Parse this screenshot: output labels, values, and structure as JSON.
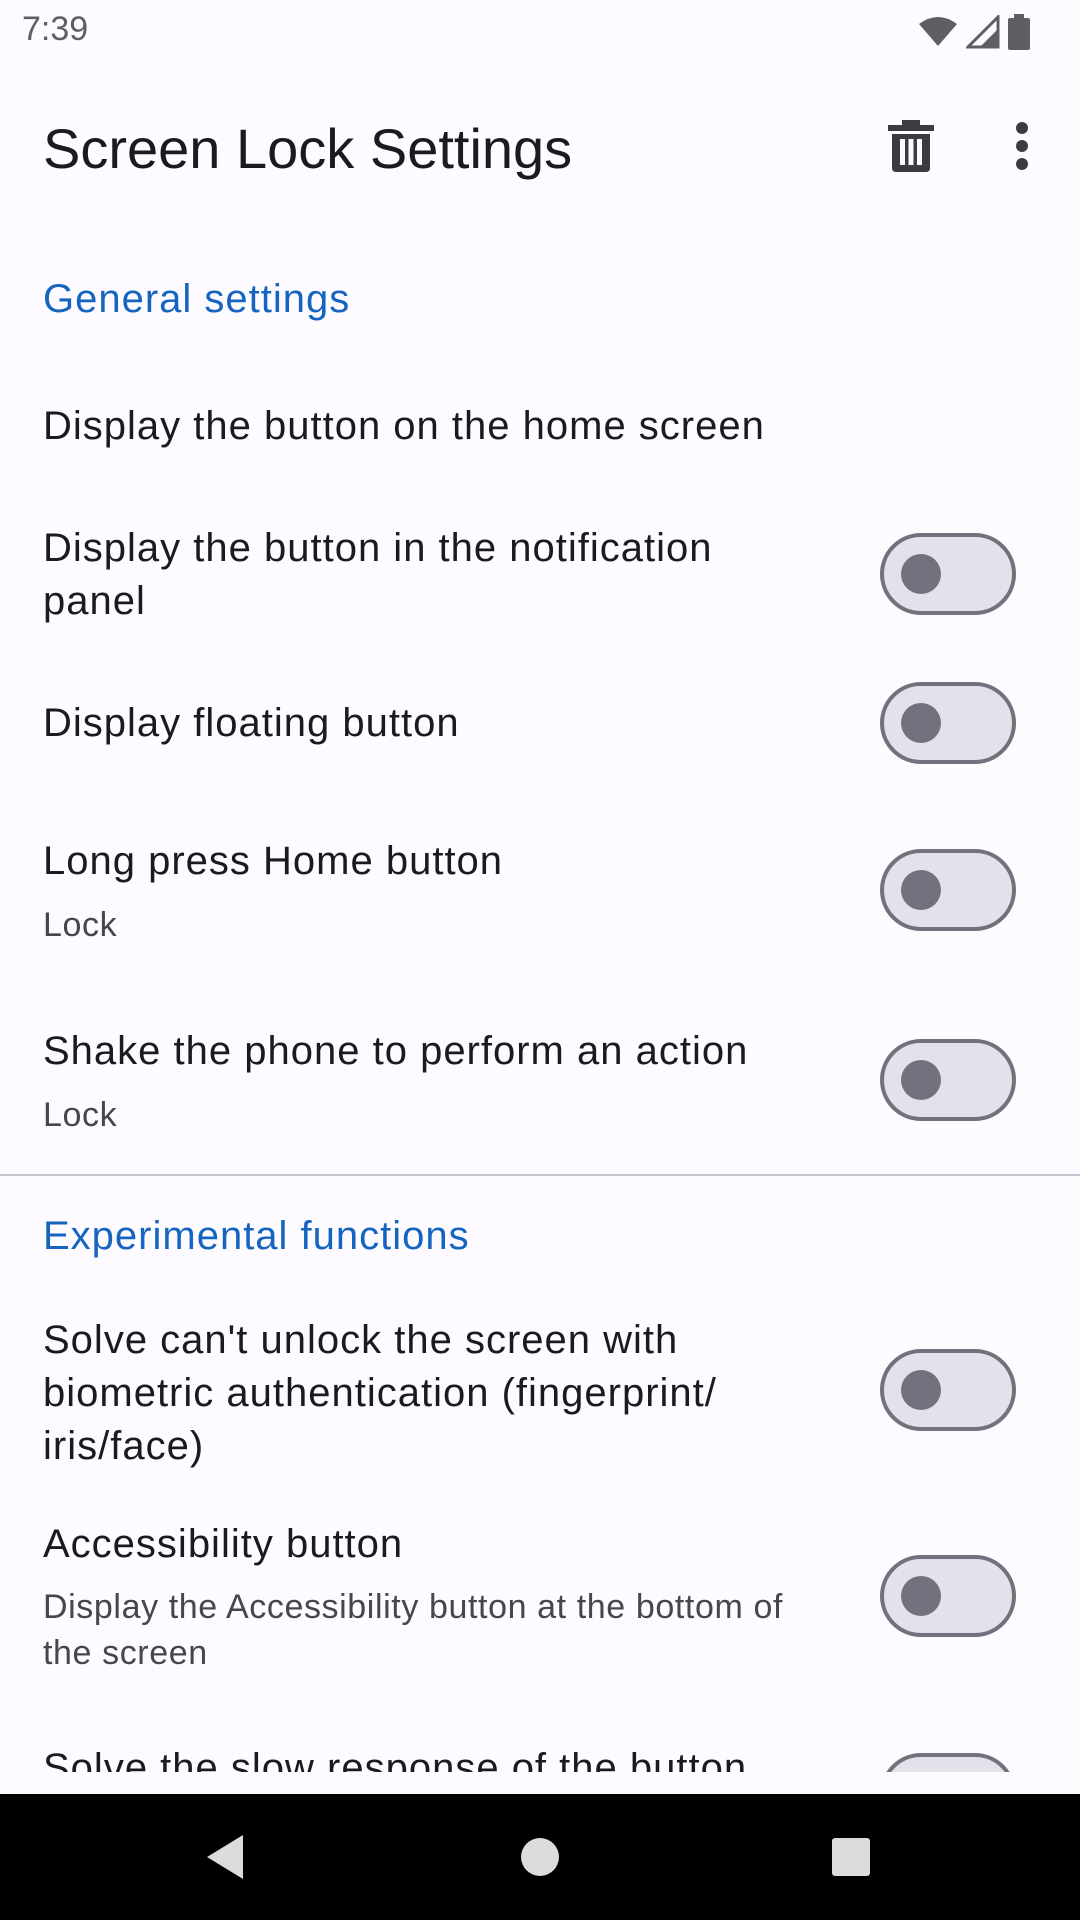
{
  "status_bar": {
    "time": "7:39",
    "icons": [
      "wifi-icon",
      "cellular-signal-icon",
      "battery-icon"
    ]
  },
  "app_bar": {
    "title": "Screen Lock Settings",
    "actions": [
      "delete-icon",
      "more-vert-icon"
    ]
  },
  "sections": {
    "general": {
      "title": "General settings",
      "items": [
        {
          "title": "Display the button on the home screen"
        },
        {
          "title": "Display the button in the notification panel",
          "switch_on": false
        },
        {
          "title": "Display floating button",
          "switch_on": false
        },
        {
          "title": "Long press Home button",
          "summary": "Lock",
          "switch_on": false
        },
        {
          "title": "Shake the phone to perform an action",
          "summary": "Lock",
          "switch_on": false
        }
      ]
    },
    "experimental": {
      "title": "Experimental functions",
      "items": [
        {
          "title": "Solve can't unlock the screen with biometric authentication (fingerprint/ iris/face)",
          "switch_on": false
        },
        {
          "title": "Accessibility button",
          "summary": "Display the Accessibility button at the bottom of the screen",
          "switch_on": false
        },
        {
          "title": "Solve the slow response of the button",
          "switch_on": false
        }
      ]
    }
  },
  "colors": {
    "accent": "#1565c0",
    "background": "#fdfbff",
    "switch_off_track": "#e3e2ea",
    "switch_off_thumb": "#72727e"
  },
  "nav_bar": {
    "buttons": [
      "back-icon",
      "home-icon",
      "recents-icon"
    ]
  }
}
